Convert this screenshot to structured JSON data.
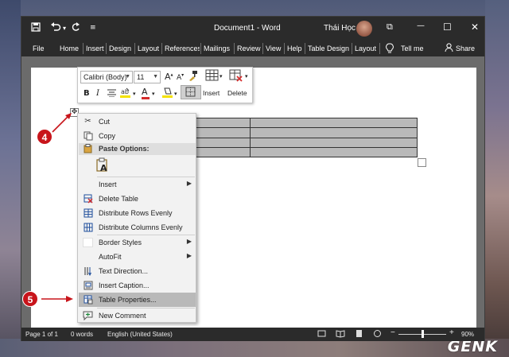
{
  "window": {
    "title": "Document1  -  Word",
    "user": "Thái Học",
    "controls": {
      "restore": "⧉",
      "minimize": "—",
      "maximize": "☐",
      "close": "✕"
    }
  },
  "quick_access": {
    "save_icon": "save-icon",
    "undo_icon": "undo-icon",
    "redo_icon": "redo-icon",
    "customize_icon": "customize-icon"
  },
  "menu": {
    "items": [
      "File",
      "Home",
      "Insert",
      "Design",
      "Layout",
      "References",
      "Mailings",
      "Review",
      "View",
      "Help",
      "Table Design",
      "Layout"
    ],
    "tell_me": "Tell me",
    "share": "Share"
  },
  "mini_toolbar": {
    "font_name": "Calibri (Body)",
    "font_size": "11",
    "grow_font": "A",
    "shrink_font": "A",
    "bold": "B",
    "italic": "I",
    "font_color": "A",
    "insert_label": "Insert",
    "delete_label": "Delete"
  },
  "context_menu": {
    "cut": "Cut",
    "copy": "Copy",
    "paste_header": "Paste Options:",
    "insert": "Insert",
    "delete_table": "Delete Table",
    "distribute_rows": "Distribute Rows Evenly",
    "distribute_cols": "Distribute Columns Evenly",
    "border_styles": "Border Styles",
    "autofit": "AutoFit",
    "text_direction": "Text Direction...",
    "insert_caption": "Insert Caption...",
    "table_properties": "Table Properties...",
    "new_comment": "New Comment"
  },
  "table": {
    "rows": 4,
    "cols": 2
  },
  "annotations": {
    "step4": "4",
    "step5": "5"
  },
  "statusbar": {
    "page": "Page 1 of 1",
    "words": "0 words",
    "language": "English (United States)",
    "zoom": "90%",
    "zoom_out": "−",
    "zoom_in": "+"
  },
  "watermark": "GENK",
  "colors": {
    "accent_red": "#c8151b",
    "titlebar": "#2b2b2b",
    "highlight": "#b9b9b9"
  }
}
